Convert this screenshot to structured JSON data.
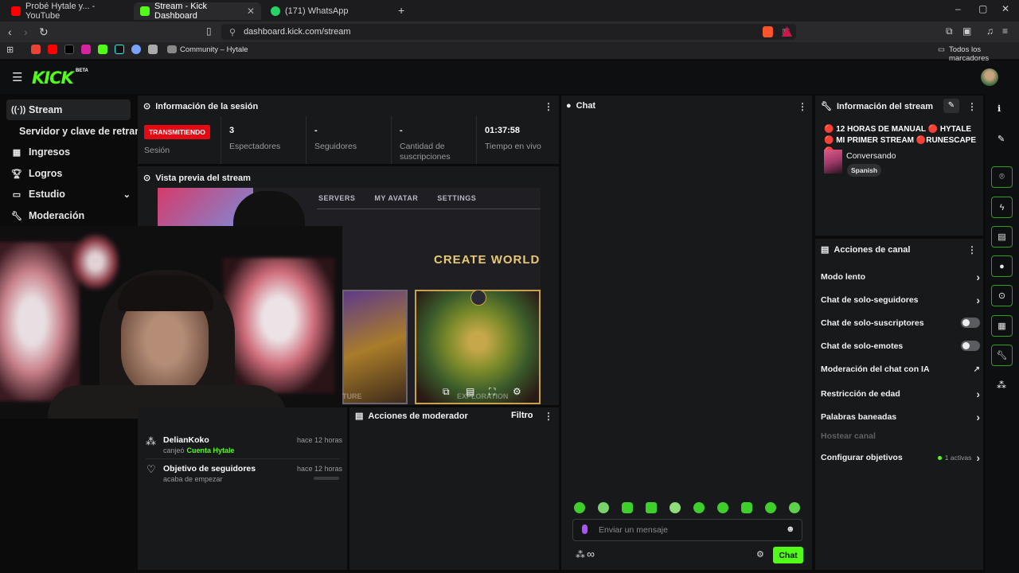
{
  "browser": {
    "tabs": [
      {
        "label": "Probé Hytale y... - YouTube",
        "color": "#ff0000"
      },
      {
        "label": "Stream - Kick Dashboard",
        "color": "#53fc18"
      },
      {
        "label": "(171) WhatsApp",
        "color": "#25d366"
      }
    ],
    "new_tab": "+",
    "url": "dashboard.kick.com/stream",
    "bookmarks": {
      "community": "Community – Hytale",
      "all": "Todos los marcadores"
    },
    "window_controls": [
      "–",
      "▢",
      "✕"
    ]
  },
  "app": {
    "logo": "KICK",
    "beta": "BETA",
    "accent": "#53fc18",
    "sidebar": [
      {
        "label": "Stream",
        "icon": "broadcast-icon"
      },
      {
        "label": "Servidor y clave de retransm",
        "icon": ""
      },
      {
        "label": "Ingresos",
        "icon": "grid-icon"
      },
      {
        "label": "Logros",
        "icon": "trophy-icon"
      },
      {
        "label": "Estudio",
        "icon": "studio-icon"
      },
      {
        "label": "Moderación",
        "icon": "wrench-icon"
      }
    ]
  },
  "session": {
    "title": "Información de la sesión",
    "badge": "TRANSMITIENDO",
    "stats": [
      {
        "value": "",
        "label": "Sesión"
      },
      {
        "value": "3",
        "label": "Espectadores"
      },
      {
        "value": "-",
        "label": "Seguidores"
      },
      {
        "value": "-",
        "label": "Cantidad de suscripciones"
      },
      {
        "value": "01:37:58",
        "label": "Tiempo en vivo"
      }
    ]
  },
  "preview": {
    "title": "Vista previa del stream",
    "game_nav": [
      "SERVERS",
      "MY AVATAR",
      "SETTINGS"
    ],
    "game_heading": "CREATE WORLD",
    "game_sub": "EXPLORATION",
    "game_sub2": "TURE"
  },
  "activity": [
    {
      "name": "DelianKoko",
      "time": "hace 12 horas",
      "text": "canjeó",
      "highlight": "Cuenta Hytale"
    },
    {
      "name": "Objetivo de seguidores",
      "time": "hace 12 horas",
      "text": "acaba de empezar",
      "highlight": ""
    }
  ],
  "mod_actions": {
    "title": "Acciones de moderador",
    "filter": "Filtro"
  },
  "chat": {
    "title": "Chat",
    "placeholder": "Enviar un mensaje",
    "send": "Chat",
    "infinity": "∞"
  },
  "stream_info": {
    "title": "Información del stream",
    "stream_title": "🔴 12 HORAS DE MANUAL 🔴 HYTALE 🔴 MI PRIMER STREAM 🔴RUNESCAPE 🔴",
    "category": "Conversando",
    "language": "Spanish"
  },
  "channel_actions": {
    "title": "Acciones de canal",
    "items": [
      {
        "label": "Modo lento",
        "control": "arrow"
      },
      {
        "label": "Chat de solo-seguidores",
        "control": "arrow"
      },
      {
        "label": "Chat de solo-suscriptores",
        "control": "toggle",
        "on": false
      },
      {
        "label": "Chat de solo-emotes",
        "control": "toggle",
        "on": false
      },
      {
        "label": "Moderación del chat con IA",
        "control": "external"
      },
      {
        "label": "Restricción de edad",
        "control": "arrow"
      },
      {
        "label": "Palabras baneadas",
        "control": "arrow"
      },
      {
        "label": "Hostear canal",
        "control": "none"
      },
      {
        "label": "Configurar objetivos",
        "control": "arrow",
        "status": "1 activas"
      }
    ]
  }
}
